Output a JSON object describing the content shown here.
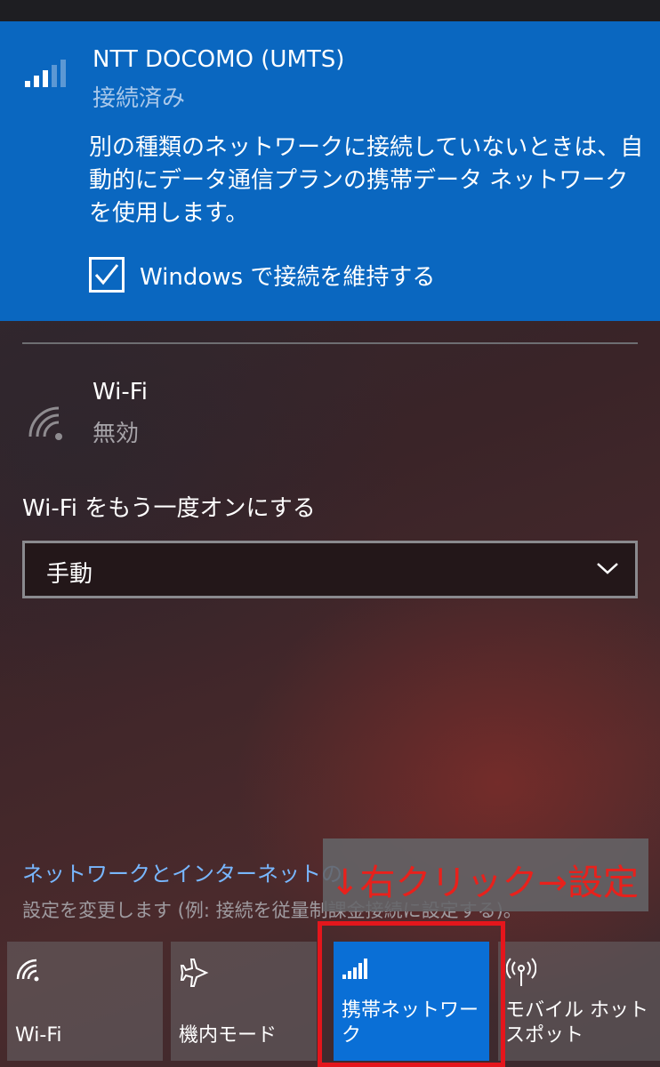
{
  "cellular": {
    "name": "NTT DOCOMO (UMTS)",
    "status": "接続済み",
    "description": "別の種類のネットワークに接続していないときは、自動的にデータ通信プランの携帯データ ネットワークを使用します。",
    "keep_connected_label": "Windows で接続を維持する",
    "keep_connected_checked": true
  },
  "wifi": {
    "name": "Wi-Fi",
    "status": "無効",
    "reenable_label": "Wi-Fi をもう一度オンにする",
    "reenable_value": "手動"
  },
  "settings": {
    "link_text": "ネットワークとインターネットの",
    "description": "設定を変更します (例: 接続を従量制課金接続に設定する)。"
  },
  "annotation": {
    "text": "↓右クリック→設定",
    "color": "#e8211c"
  },
  "quick_actions": [
    {
      "label": "Wi-Fi",
      "icon": "wifi-icon",
      "active": false
    },
    {
      "label": "機内モード",
      "icon": "airplane-icon",
      "active": false
    },
    {
      "label": "携帯ネットワーク",
      "icon": "cellular-signal-icon",
      "active": true
    },
    {
      "label": "モバイル ホットスポット",
      "icon": "mobile-hotspot-icon",
      "active": false
    }
  ],
  "colors": {
    "accent": "#0a67c0",
    "active_tile": "#0a6fd6",
    "link": "#78b7ff",
    "highlight_border": "#e4161c"
  }
}
